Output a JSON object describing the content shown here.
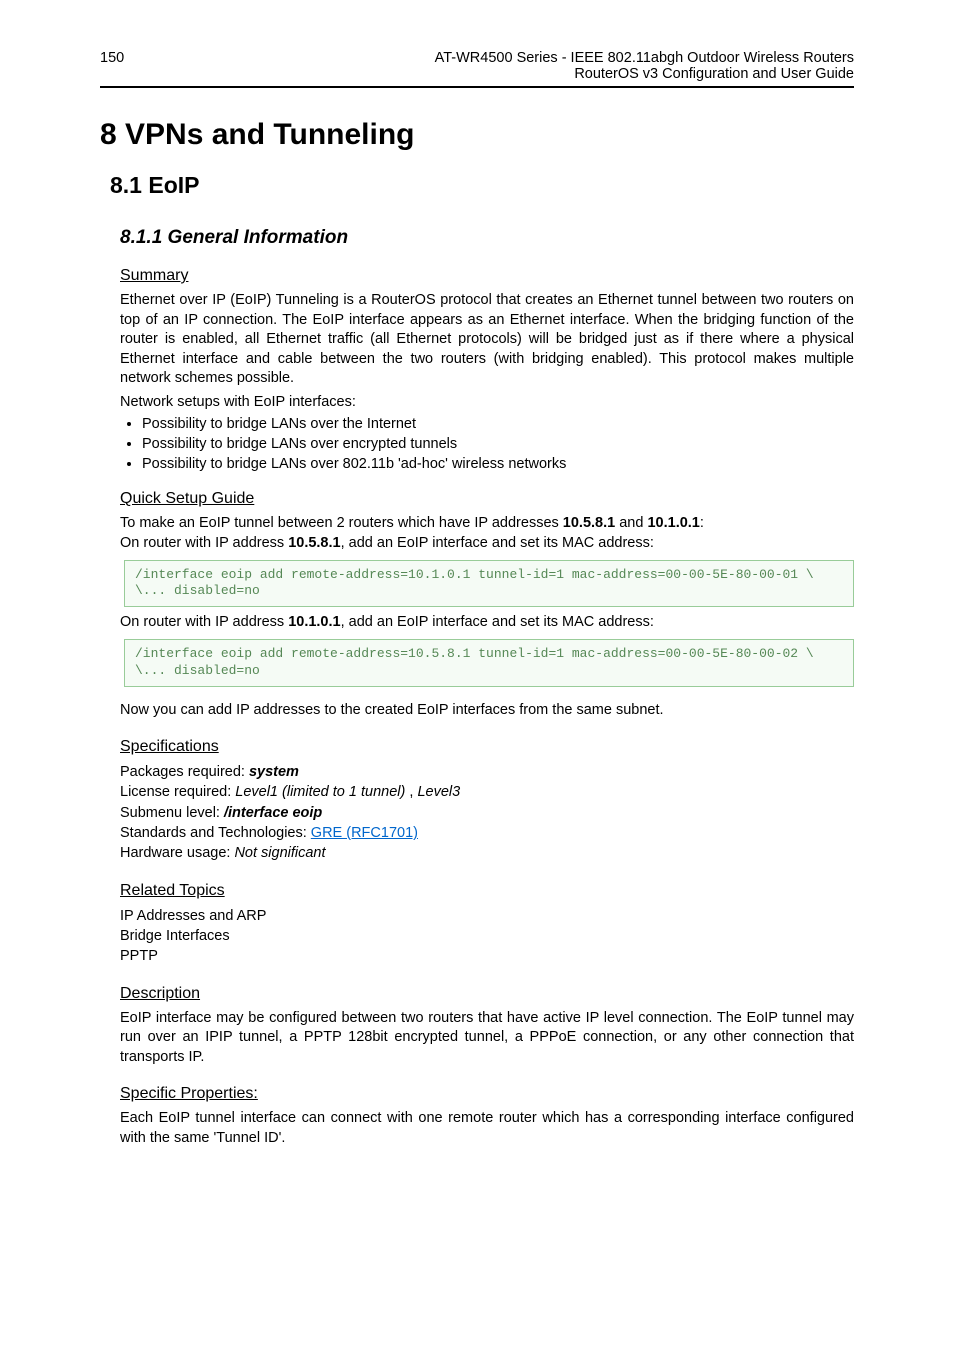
{
  "header": {
    "page_number": "150",
    "title_line1": "AT-WR4500 Series - IEEE 802.11abgh Outdoor Wireless Routers",
    "title_line2": "RouterOS v3 Configuration and User Guide"
  },
  "h1": "8  VPNs and Tunneling",
  "h2": "8.1 EoIP",
  "h3": "8.1.1  General Information",
  "summary": {
    "heading": "Summary",
    "para": "Ethernet over IP (EoIP) Tunneling is a RouterOS protocol that creates an Ethernet tunnel between two routers on top of an IP connection. The EoIP interface appears as an Ethernet interface. When the bridging function of the router is enabled, all Ethernet traffic (all Ethernet protocols) will be bridged just as if there where a physical Ethernet interface and cable between the two routers (with bridging enabled). This protocol makes multiple network schemes possible.",
    "para2": "Network setups with EoIP interfaces:",
    "bullets": [
      "Possibility to bridge LANs over the Internet",
      "Possibility to bridge LANs over encrypted tunnels",
      "Possibility to bridge LANs over 802.11b 'ad-hoc' wireless networks"
    ]
  },
  "quick_setup": {
    "heading": "Quick Setup Guide",
    "line1_a": "To make an EoIP tunnel between 2 routers which have IP addresses ",
    "line1_b": "10.5.8.1",
    "line1_c": " and ",
    "line1_d": "10.1.0.1",
    "line1_e": ":",
    "line2_a": "On router with IP address ",
    "line2_b": "10.5.8.1",
    "line2_c": ", add an EoIP interface and set its MAC address:",
    "code1": "/interface eoip add remote-address=10.1.0.1 tunnel-id=1 mac-address=00-00-5E-80-00-01 \\\n\\... disabled=no",
    "line3_a": "On router with IP address ",
    "line3_b": "10.1.0.1",
    "line3_c": ", add an EoIP interface and set its MAC address:",
    "code2": "/interface eoip add remote-address=10.5.8.1 tunnel-id=1 mac-address=00-00-5E-80-00-02 \\\n\\... disabled=no",
    "line4": "Now you can add IP addresses to the created EoIP interfaces from the same subnet."
  },
  "specifications": {
    "heading": "Specifications",
    "l1a": "Packages required: ",
    "l1b": "system",
    "l2a": "License required: ",
    "l2b": "Level1 (limited to 1 tunnel)",
    "l2c": " , ",
    "l2d": "Level3",
    "l3a": "Submenu level: ",
    "l3b": "/interface eoip",
    "l4a": "Standards and Technologies: ",
    "l4b": "GRE (RFC1701)",
    "l5a": "Hardware usage: ",
    "l5b": "Not significant"
  },
  "related": {
    "heading": "Related Topics",
    "items": [
      "IP Addresses and ARP",
      "Bridge Interfaces",
      "PPTP"
    ]
  },
  "description": {
    "heading": "Description",
    "para": "EoIP interface may be configured between two routers that have active IP level connection. The EoIP tunnel may run over an IPIP tunnel, a PPTP 128bit encrypted tunnel, a PPPoE connection, or any other connection that transports IP."
  },
  "specific": {
    "heading": "Specific Properties:",
    "para": "Each EoIP tunnel interface can connect with one remote router which has a corresponding interface configured with the same 'Tunnel ID'."
  }
}
